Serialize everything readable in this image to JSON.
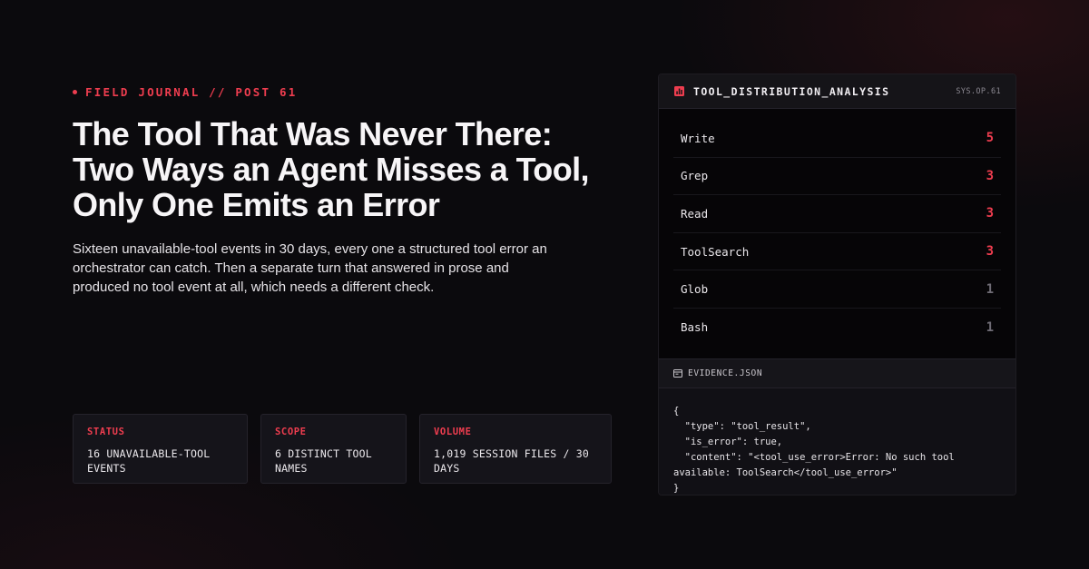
{
  "eyebrow": "FIELD JOURNAL // POST 61",
  "title_lines": [
    "The Tool That Was Never There:",
    "Two Ways an Agent Misses a Tool,",
    "Only One Emits an Error"
  ],
  "subtitle_lines": [
    "Sixteen unavailable-tool events in 30 days, every one a structured tool error an",
    "orchestrator can catch. Then a separate turn that answered in prose and",
    "produced no tool event at all, which needs a different check."
  ],
  "stats": [
    {
      "label": "STATUS",
      "value_lines": [
        "16 UNAVAILABLE-TOOL",
        "EVENTS"
      ]
    },
    {
      "label": "SCOPE",
      "value_lines": [
        "6 DISTINCT TOOL",
        "NAMES"
      ]
    },
    {
      "label": "VOLUME",
      "value_lines": [
        "1,019 SESSION FILES / 30",
        "DAYS"
      ]
    }
  ],
  "panel": {
    "title": "TOOL_DISTRIBUTION_ANALYSIS",
    "code": "SYS.OP.61",
    "icon": "bar-chart-icon"
  },
  "tools": [
    {
      "name": "Write",
      "count": "5"
    },
    {
      "name": "Grep",
      "count": "3"
    },
    {
      "name": "Read",
      "count": "3"
    },
    {
      "name": "ToolSearch",
      "count": "3"
    },
    {
      "name": "Glob",
      "count": "1"
    },
    {
      "name": "Bash",
      "count": "1"
    }
  ],
  "evidence": {
    "title": "EVIDENCE.JSON",
    "icon": "file-icon",
    "code_lines": [
      "{",
      "  \"type\": \"tool_result\",",
      "  \"is_error\": true,",
      "  \"content\": \"<tool_use_error>Error: No such tool",
      "available: ToolSearch</tool_use_error>\"",
      "}"
    ]
  },
  "colors": {
    "accent": "#ee3d4f",
    "background": "#0b0a0d",
    "muted_count": "#6f6c75"
  }
}
